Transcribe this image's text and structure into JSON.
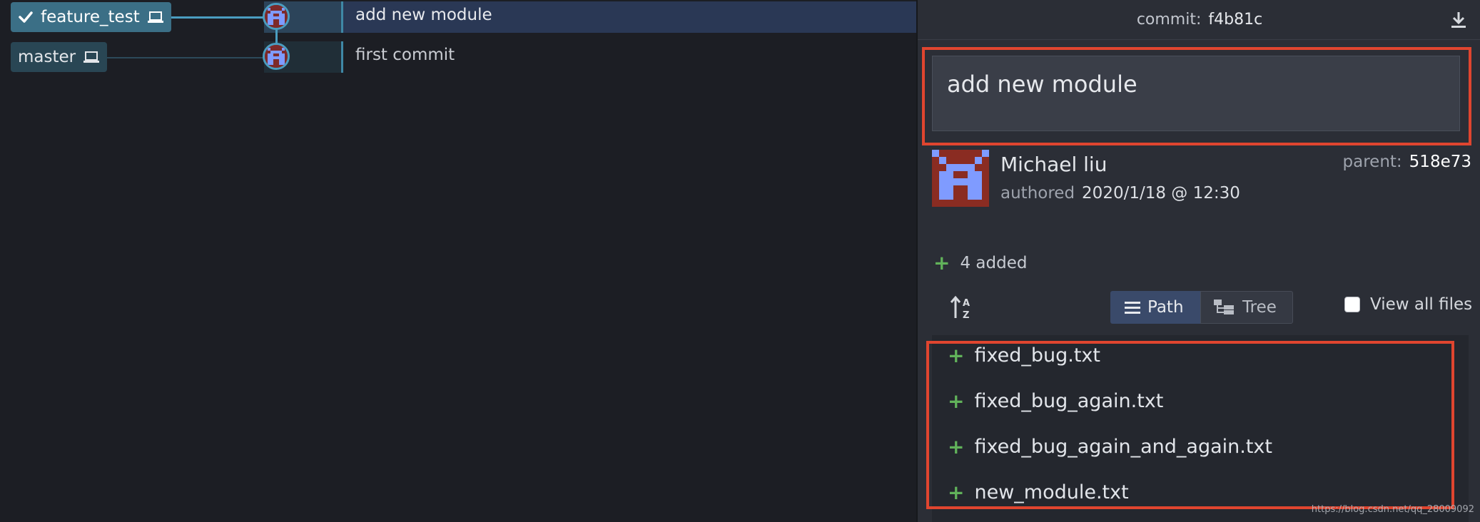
{
  "graph": {
    "branches": [
      {
        "name": "feature_test",
        "current": true
      },
      {
        "name": "master",
        "current": false
      }
    ],
    "commits": [
      {
        "message": "add new module",
        "selected": true
      },
      {
        "message": "first commit",
        "selected": false
      }
    ]
  },
  "detail": {
    "header": {
      "label": "commit:",
      "sha": "f4b81c"
    },
    "summary": "add new module",
    "author": {
      "name": "Michael liu",
      "authored_label": "authored",
      "authored_date": "2020/1/18 @ 12:30"
    },
    "parent": {
      "label": "parent:",
      "sha": "518e73"
    },
    "added_summary": "4 added",
    "view_toggle": {
      "path_label": "Path",
      "tree_label": "Tree",
      "selected": "Path"
    },
    "view_all_files": {
      "label": "View all files",
      "checked": false
    },
    "files": [
      {
        "status": "added",
        "name": "fixed_bug.txt"
      },
      {
        "status": "added",
        "name": "fixed_bug_again.txt"
      },
      {
        "status": "added",
        "name": "fixed_bug_again_and_again.txt"
      },
      {
        "status": "added",
        "name": "new_module.txt"
      }
    ]
  },
  "watermark": "https://blog.csdn.net/qq_28009092",
  "colors": {
    "accent": "#4a9dc0",
    "highlight_red": "#e0452f",
    "added_green": "#61b25a",
    "selected_row": "#2a3855"
  },
  "icons": [
    "checkmark-icon",
    "laptop-icon",
    "download-icon",
    "sort-az-icon",
    "list-icon",
    "tree-icon",
    "plus-icon",
    "avatar-icon"
  ]
}
